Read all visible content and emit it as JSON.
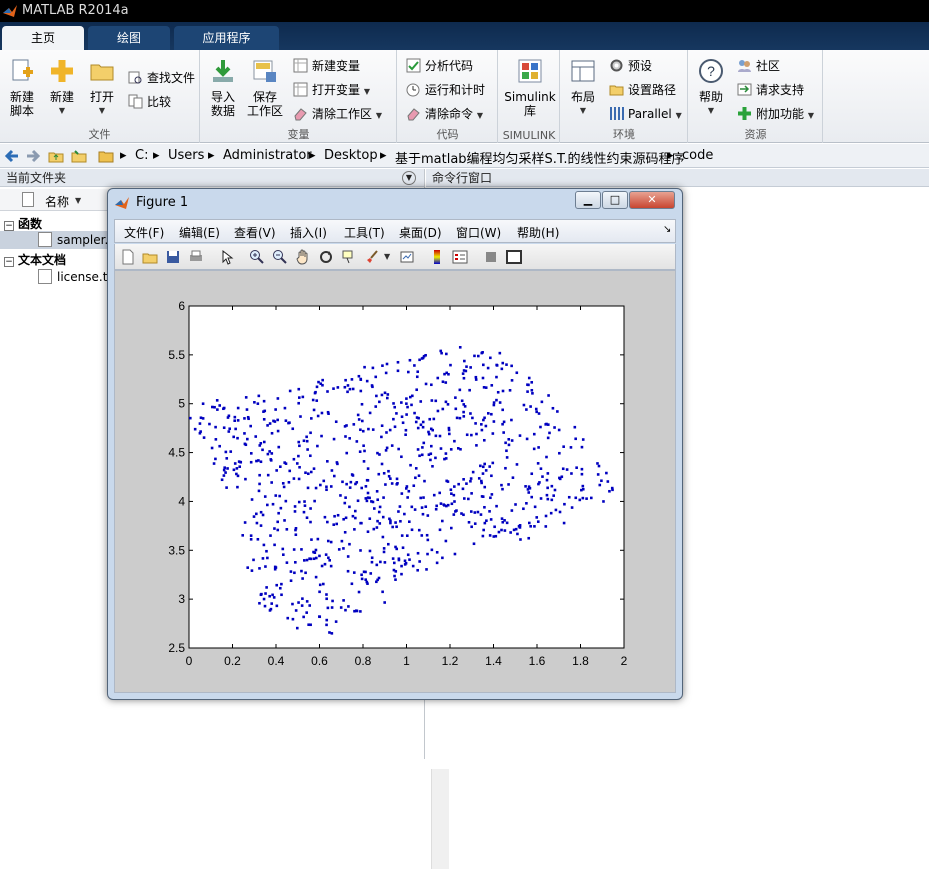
{
  "app": {
    "title": "MATLAB R2014a"
  },
  "tabs": [
    {
      "label": "主页"
    },
    {
      "label": "绘图"
    },
    {
      "label": "应用程序"
    }
  ],
  "ribbon": {
    "file": {
      "label": "文件",
      "new_script": "新建\n脚本",
      "new": "新建",
      "open": "打开",
      "find_files": "查找文件",
      "compare": "比较"
    },
    "variable": {
      "label": "变量",
      "import": "导入\n数据",
      "save_ws": "保存\n工作区",
      "new_var": "新建变量",
      "open_var": "打开变量",
      "clear_ws": "清除工作区"
    },
    "code": {
      "label": "代码",
      "analyze": "分析代码",
      "run_time": "运行和计时",
      "clear_cmd": "清除命令"
    },
    "simulink": {
      "label": "SIMULINK",
      "lib": "Simulink\n库"
    },
    "env": {
      "label": "环境",
      "layout": "布局",
      "prefs": "预设",
      "set_path": "设置路径",
      "parallel": "Parallel"
    },
    "resources": {
      "label": "资源",
      "help": "帮助",
      "community": "社区",
      "support": "请求支持",
      "addons": "附加功能"
    }
  },
  "path": {
    "crumbs": [
      "C:",
      "Users",
      "Administrator",
      "Desktop",
      "基于matlab编程均匀采样S.T.的线性约束源码程序",
      "code"
    ]
  },
  "left_pane": {
    "title": "当前文件夹",
    "col_name": "名称",
    "groups": [
      {
        "label": "函数",
        "files": [
          "sampler.m"
        ]
      },
      {
        "label": "文本文档",
        "files": [
          "license.txt"
        ]
      }
    ]
  },
  "right_pane": {
    "title": "命令行窗口"
  },
  "figure": {
    "title": "Figure 1",
    "menu": [
      "文件(F)",
      "编辑(E)",
      "查看(V)",
      "插入(I)",
      "工具(T)",
      "桌面(D)",
      "窗口(W)",
      "帮助(H)"
    ]
  },
  "chart_data": {
    "type": "scatter",
    "xlim": [
      0,
      2
    ],
    "ylim": [
      2.5,
      6
    ],
    "xticks": [
      "0",
      "0.2",
      "0.4",
      "0.6",
      "0.8",
      "1",
      "1.2",
      "1.4",
      "1.6",
      "1.8",
      "2"
    ],
    "yticks": [
      "2.5",
      "3",
      "3.5",
      "4",
      "4.5",
      "5",
      "5.5",
      "6"
    ],
    "marker_color": "#0000c0",
    "n_points": 900,
    "region": [
      [
        0.0,
        5.0
      ],
      [
        0.5,
        5.15
      ],
      [
        0.8,
        5.4
      ],
      [
        1.4,
        5.65
      ],
      [
        1.7,
        5.0
      ],
      [
        2.0,
        4.05
      ],
      [
        1.55,
        3.6
      ],
      [
        1.3,
        3.55
      ],
      [
        1.05,
        3.2
      ],
      [
        0.7,
        2.65
      ],
      [
        0.5,
        2.5
      ],
      [
        0.3,
        3.0
      ],
      [
        0.2,
        4.0
      ],
      [
        0.0,
        4.85
      ]
    ],
    "title": "",
    "xlabel": "",
    "ylabel": "",
    "grid": false
  }
}
